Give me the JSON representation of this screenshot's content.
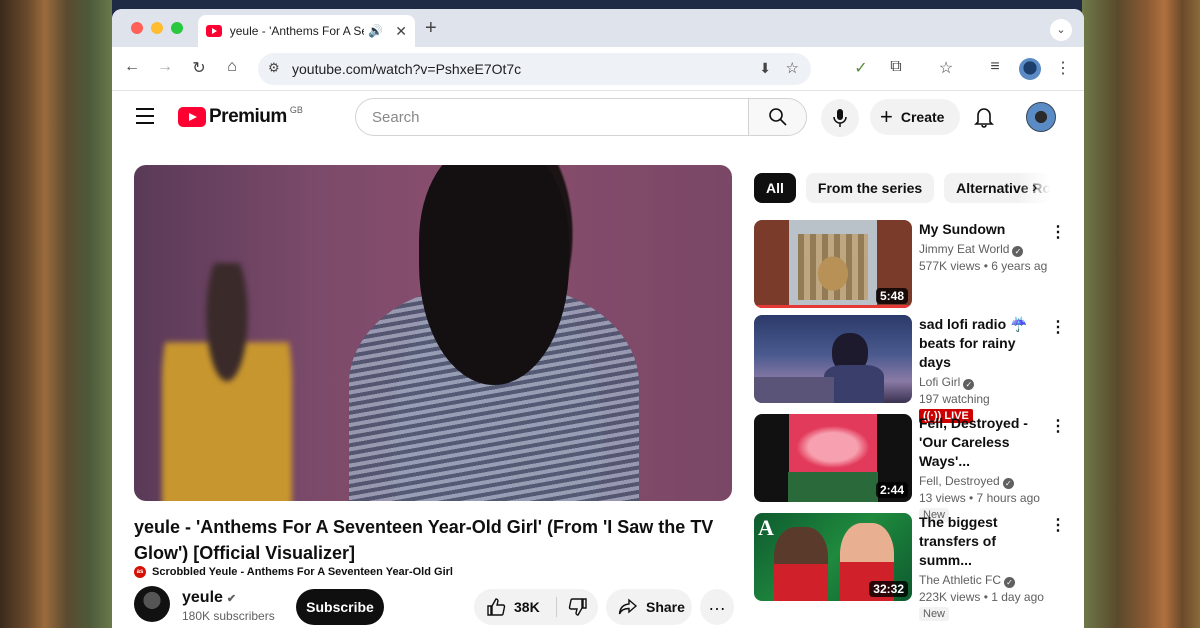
{
  "browser": {
    "tab_title": "yeule - 'Anthems For A Se",
    "new_tab_label": "+",
    "url": "youtube.com/watch?v=PshxeE7Ot7c"
  },
  "header": {
    "logo_text": "Premium",
    "country_code": "GB",
    "search_placeholder": "Search",
    "create_label": "Create"
  },
  "video": {
    "title": "yeule - 'Anthems For A Seventeen Year-Old Girl' (From 'I Saw the TV Glow') [Official Visualizer]",
    "scrobble_text": "Scrobbled Yeule - Anthems For A Seventeen Year-Old Girl",
    "channel_name": "yeule",
    "subscribers": "180K subscribers",
    "subscribe_label": "Subscribe",
    "likes": "38K",
    "share_label": "Share"
  },
  "chips": [
    {
      "label": "All",
      "active": true
    },
    {
      "label": "From the series",
      "active": false
    },
    {
      "label": "Alternative Rock",
      "active": false
    }
  ],
  "related": [
    {
      "title": "My Sundown",
      "channel": "Jimmy Eat World",
      "meta": "577K views • 6 years ago",
      "duration": "5:48",
      "badge": ""
    },
    {
      "title": "sad lofi radio ☔ beats for rainy days",
      "channel": "Lofi Girl",
      "meta": "197 watching",
      "duration": "",
      "badge": "LIVE"
    },
    {
      "title": "Fell, Destroyed - 'Our Careless Ways'...",
      "channel": "Fell, Destroyed",
      "meta": "13 views • 7 hours ago",
      "duration": "2:44",
      "badge": "New"
    },
    {
      "title": "The biggest transfers of summ...",
      "channel": "The Athletic FC",
      "meta": "223K views • 1 day ago",
      "duration": "32:32",
      "badge": "New"
    }
  ]
}
